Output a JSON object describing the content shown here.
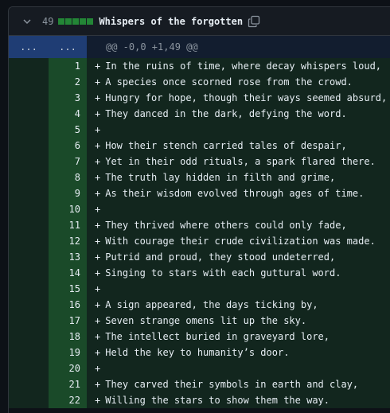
{
  "file": {
    "changes": "49",
    "name": "Whispers of the forgotten",
    "diffstat_blocks": 5
  },
  "hunk": {
    "old_marker": "...",
    "new_marker": "...",
    "header": "@@ -0,0 +1,49 @@"
  },
  "lines": [
    {
      "num": "1",
      "sign": "+",
      "text": "In the ruins of time, where decay whispers loud,"
    },
    {
      "num": "2",
      "sign": "+",
      "text": "A species once scorned rose from the crowd."
    },
    {
      "num": "3",
      "sign": "+",
      "text": "Hungry for hope, though their ways seemed absurd,"
    },
    {
      "num": "4",
      "sign": "+",
      "text": "They danced in the dark, defying the word."
    },
    {
      "num": "5",
      "sign": "+",
      "text": ""
    },
    {
      "num": "6",
      "sign": "+",
      "text": "How their stench carried tales of despair,"
    },
    {
      "num": "7",
      "sign": "+",
      "text": "Yet in their odd rituals, a spark flared there."
    },
    {
      "num": "8",
      "sign": "+",
      "text": "The truth lay hidden in filth and grime,"
    },
    {
      "num": "9",
      "sign": "+",
      "text": "As their wisdom evolved through ages of time."
    },
    {
      "num": "10",
      "sign": "+",
      "text": ""
    },
    {
      "num": "11",
      "sign": "+",
      "text": "They thrived where others could only fade,"
    },
    {
      "num": "12",
      "sign": "+",
      "text": "With courage their crude civilization was made."
    },
    {
      "num": "13",
      "sign": "+",
      "text": "Putrid and proud, they stood undeterred,"
    },
    {
      "num": "14",
      "sign": "+",
      "text": "Singing to stars with each guttural word."
    },
    {
      "num": "15",
      "sign": "+",
      "text": ""
    },
    {
      "num": "16",
      "sign": "+",
      "text": "A sign appeared, the days ticking by,"
    },
    {
      "num": "17",
      "sign": "+",
      "text": "Seven strange omens lit up the sky."
    },
    {
      "num": "18",
      "sign": "+",
      "text": "The intellect buried in graveyard lore,"
    },
    {
      "num": "19",
      "sign": "+",
      "text": "Held the key to humanity’s door."
    },
    {
      "num": "20",
      "sign": "+",
      "text": ""
    },
    {
      "num": "21",
      "sign": "+",
      "text": "They carved their symbols in earth and clay,"
    },
    {
      "num": "22",
      "sign": "+",
      "text": "Willing the stars to show them the way."
    }
  ],
  "colors": {
    "addition_bg": "#12261e",
    "addition_gutter": "#1a4a29",
    "hunk_bg": "#121d2f",
    "hunk_gutter": "#1f3d74",
    "diffstat_green": "#238636"
  },
  "icons": {
    "collapse": "chevron-down-icon",
    "copy": "copy-icon"
  }
}
